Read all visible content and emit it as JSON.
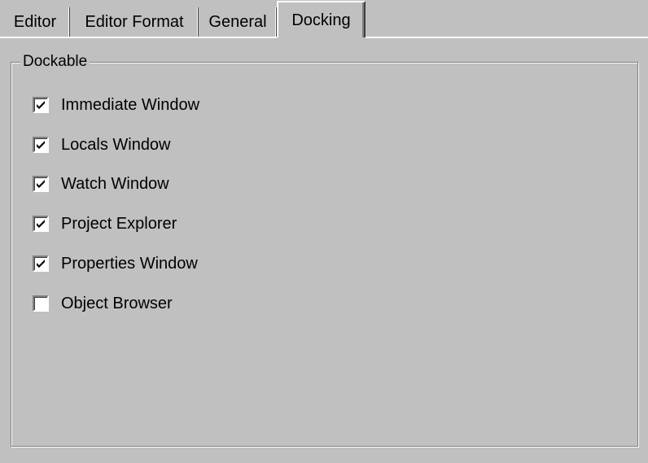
{
  "tabs": [
    {
      "label": "Editor",
      "active": false
    },
    {
      "label": "Editor Format",
      "active": false
    },
    {
      "label": "General",
      "active": false
    },
    {
      "label": "Docking",
      "active": true
    }
  ],
  "group": {
    "title": "Dockable",
    "items": [
      {
        "label": "Immediate Window",
        "checked": true
      },
      {
        "label": "Locals Window",
        "checked": true
      },
      {
        "label": "Watch Window",
        "checked": true
      },
      {
        "label": "Project Explorer",
        "checked": true
      },
      {
        "label": "Properties Window",
        "checked": true
      },
      {
        "label": "Object Browser",
        "checked": false
      }
    ]
  }
}
